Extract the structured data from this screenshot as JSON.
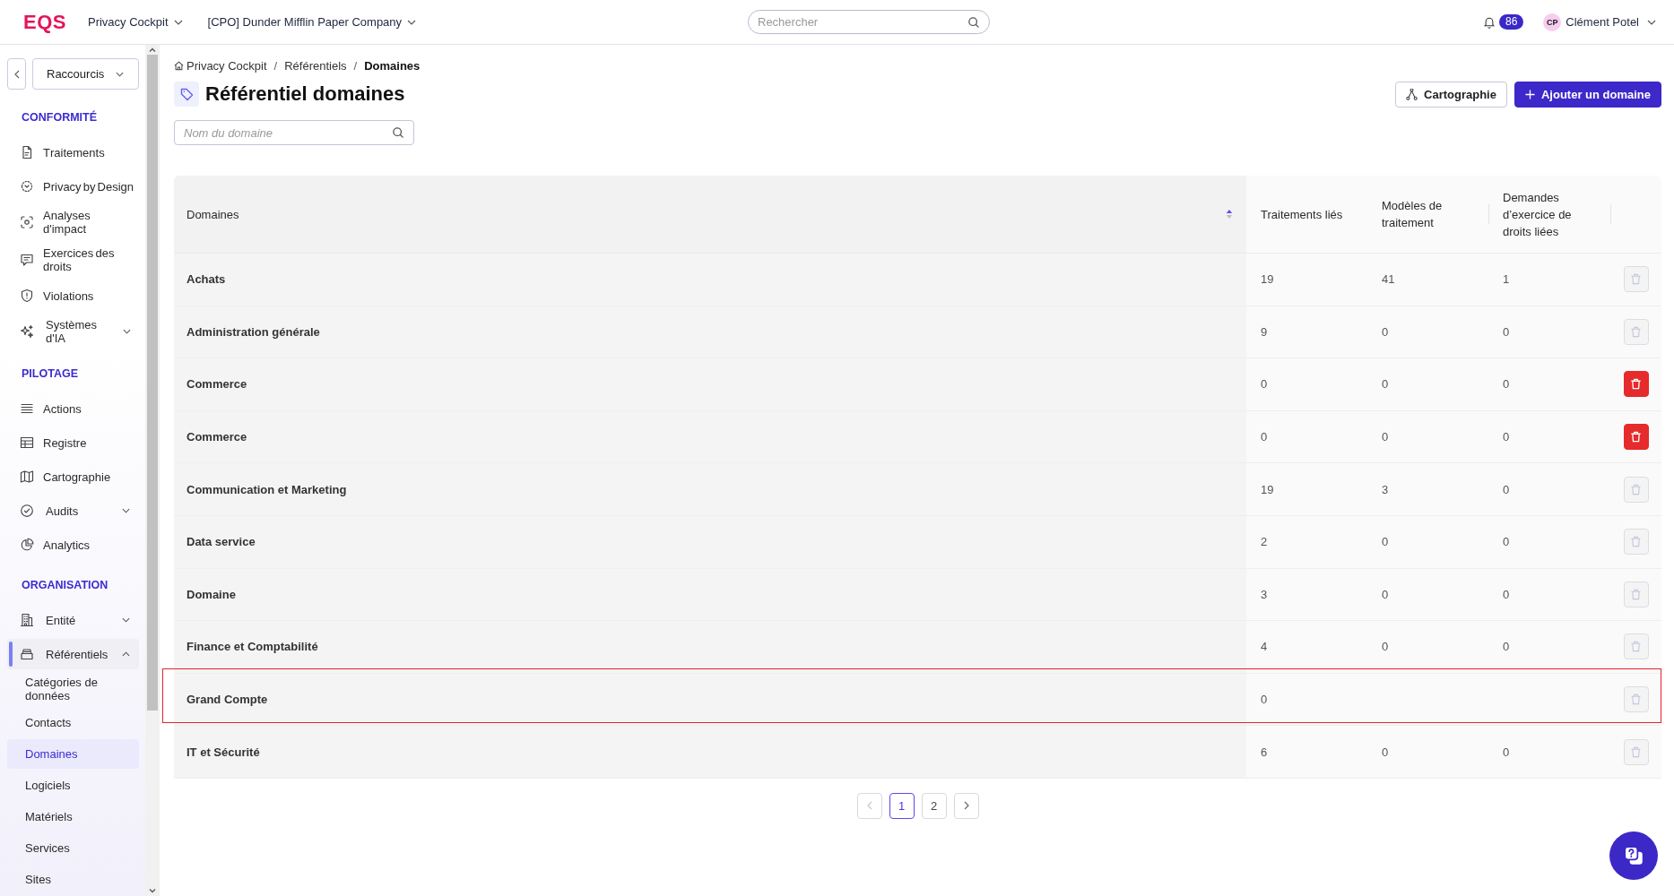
{
  "topbar": {
    "logo": "EQS",
    "menus": [
      {
        "label": "Privacy Cockpit"
      },
      {
        "label": "[CPO] Dunder Mifflin Paper Company"
      }
    ],
    "search": {
      "placeholder": "Rechercher"
    },
    "notifications": {
      "count": "86"
    },
    "user": {
      "initials": "CP",
      "name": "Clément Potel"
    }
  },
  "sidebar": {
    "shortcuts": {
      "label": "Raccourcis"
    },
    "sections": [
      {
        "title": "CONFORMITÉ",
        "items": [
          {
            "label": "Traitements",
            "selected": false
          },
          {
            "label": "Privacy by Design",
            "selected": false
          },
          {
            "label": "Analyses d'impact",
            "selected": false
          },
          {
            "label": "Exercices des droits",
            "selected": false
          },
          {
            "label": "Violations",
            "selected": false
          },
          {
            "label": "Systèmes d'IA",
            "selected": false,
            "expanded": false
          }
        ]
      },
      {
        "title": "PILOTAGE",
        "items": [
          {
            "label": "Actions",
            "selected": false
          },
          {
            "label": "Registre",
            "selected": false
          },
          {
            "label": "Cartographie",
            "selected": false
          },
          {
            "label": "Audits",
            "selected": false,
            "expanded": false
          },
          {
            "label": "Analytics",
            "selected": false
          }
        ]
      },
      {
        "title": "ORGANISATION",
        "items": [
          {
            "label": "Entité",
            "selected": false,
            "expanded": false
          },
          {
            "label": "Référentiels",
            "selected": true,
            "expanded": true,
            "children": [
              {
                "label": "Catégories de données",
                "selected": false
              },
              {
                "label": "Contacts",
                "selected": false
              },
              {
                "label": "Domaines",
                "selected": true
              },
              {
                "label": "Logiciels",
                "selected": false
              },
              {
                "label": "Matériels",
                "selected": false
              },
              {
                "label": "Services",
                "selected": false
              },
              {
                "label": "Sites",
                "selected": false
              }
            ]
          }
        ]
      }
    ]
  },
  "breadcrumb": {
    "separator": "/",
    "items": [
      {
        "label": "Privacy Cockpit"
      },
      {
        "label": "Référentiels"
      },
      {
        "label": "Domaines"
      }
    ]
  },
  "page": {
    "title": "Référentiel domaines",
    "buttons": [
      {
        "label": "Cartographie",
        "kind": "secondary"
      },
      {
        "label": "Ajouter un domaine",
        "kind": "primary"
      }
    ],
    "search": {
      "placeholder": "Nom du domaine"
    }
  },
  "table": {
    "columns": [
      {
        "label": "Domaines",
        "sorted": true,
        "ascending": true
      },
      {
        "label": "Traitements liés",
        "sorted": false
      },
      {
        "label": "Modèles de traitement",
        "sorted": false
      },
      {
        "label": "Demandes d’exercice de droits liées",
        "sorted": false
      }
    ],
    "rows": [
      {
        "cells": [
          "Achats",
          "19",
          "41",
          "1"
        ],
        "delete_disabled": true,
        "highlighted": false
      },
      {
        "cells": [
          "Administration générale",
          "9",
          "0",
          "0"
        ],
        "delete_disabled": true,
        "highlighted": false
      },
      {
        "cells": [
          "Commerce",
          "0",
          "0",
          "0"
        ],
        "delete_disabled": false,
        "highlighted": false
      },
      {
        "cells": [
          "Commerce",
          "0",
          "0",
          "0"
        ],
        "delete_disabled": false,
        "highlighted": false
      },
      {
        "cells": [
          "Communication et Marketing",
          "19",
          "3",
          "0"
        ],
        "delete_disabled": true,
        "highlighted": false
      },
      {
        "cells": [
          "Data service",
          "2",
          "0",
          "0"
        ],
        "delete_disabled": true,
        "highlighted": false
      },
      {
        "cells": [
          "Domaine",
          "3",
          "0",
          "0"
        ],
        "delete_disabled": true,
        "highlighted": false
      },
      {
        "cells": [
          "Finance et Comptabilité",
          "4",
          "0",
          "0"
        ],
        "delete_disabled": true,
        "highlighted": false
      },
      {
        "cells": [
          "Grand Compte",
          "0"
        ],
        "delete_disabled": true,
        "highlighted": true
      },
      {
        "cells": [
          "IT et Sécurité",
          "6",
          "0",
          "0"
        ],
        "delete_disabled": true,
        "highlighted": false
      }
    ]
  },
  "pagination": {
    "prev_disabled": true,
    "next_disabled": false,
    "pages": [
      {
        "label": "1",
        "selected": true
      },
      {
        "label": "2",
        "selected": false
      }
    ]
  }
}
